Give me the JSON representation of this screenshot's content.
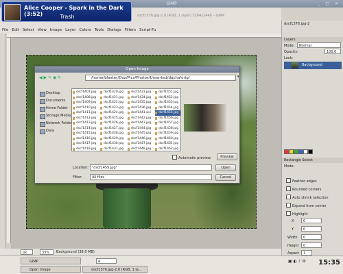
{
  "window": {
    "title": "GIMP",
    "controls": "_ □ ×"
  },
  "notification": {
    "title": "Alice Cooper - Spark in the Dark (3:52)",
    "subtitle": "Trash"
  },
  "image_window": {
    "title": "dscf1376.jpg-2.0 (RGB, 1 layer) 3264x2448 – GIMP"
  },
  "menubar": [
    "File",
    "Edit",
    "Select",
    "View",
    "Image",
    "Layer",
    "Colors",
    "Tools",
    "Dialogs",
    "Filters",
    "Script-Fu"
  ],
  "dialog": {
    "title": "Open Image",
    "path": "/home/blaster/Dox/Pics/Photos/Unsorted/dacha/orig/",
    "places": [
      "Desktop",
      "Documents",
      "Home Folder",
      "Storage Media",
      "Network Folders",
      "Data"
    ],
    "file_columns": [
      [
        "dscf1407.jpg",
        "dscf1408.jpg",
        "dscf1409.jpg",
        "dscf1410.jpg",
        "dscf1411.jpg",
        "dscf1412.jpg",
        "dscf1413.jpg",
        "dscf1414.jpg",
        "dscf1415.jpg",
        "dscf1416.jpg",
        "dscf1417.jpg",
        "dscf1418.jpg",
        "dscf1419.jpg"
      ],
      [
        "dscf1420.jpg",
        "dscf1421.jpg",
        "dscf1422.jpg",
        "dscf1423.jpg",
        "dscf1424.jpg",
        "dscf1425.jpg",
        "dscf1426.jpg",
        "dscf1427.jpg",
        "dscf1428.jpg",
        "dscf1429.jpg",
        "dscf1430.jpg",
        "dscf1431.jpg",
        "dscf1432.jpg"
      ],
      [
        "dscf1433.jpg",
        "dscf1434.jpg",
        "dscf1435.jpg",
        "dscf1436.jpg",
        "dscf1441.avi",
        "dscf1442.jpg",
        "dscf1443.jpg",
        "dscf1444.jpg",
        "dscf1445.jpg",
        "dscf1446.jpg",
        "dscf1447.jpg",
        "dscf1448.jpg",
        "dscf1449.jpg"
      ],
      [
        "dscf1451.jpg",
        "dscf1452.jpg",
        "dscf1453.jpg",
        "dscf1454.jpg",
        "dscf1455.jpg",
        "dscf1456.jpg",
        "dscf1457.jpg",
        "dscf1458.jpg",
        "dscf1459.jpg",
        "dscf1460.jpg",
        "dscf1461.jpg",
        "dscf1462.jpg",
        "dscf1463.jpg"
      ]
    ],
    "selected_file": "dscf1455.jpg",
    "automatic_preview": "Automatic preview",
    "preview_button": "Preview",
    "location_label": "Location:",
    "location_value": "\"dscf1455.jpg\"",
    "filter_label": "Filter:",
    "filter_value": "All files",
    "open_button": "Open",
    "cancel_button": "Cancel"
  },
  "statusbar": {
    "unit": "px",
    "zoom": "33%",
    "layer_info": "Background (38.0 MB)"
  },
  "right_panel": {
    "doc_title": "dscf1376.jpg-2",
    "layers_title": "Layers",
    "mode_label": "Mode:",
    "mode_value": "Normal",
    "opacity_label": "Opacity:",
    "opacity_value": "100.0",
    "lock_label": "Lock:",
    "layer_name": "Background",
    "tool_title": "Rectangle Select",
    "tool_mode": "Mode:",
    "options": [
      "Feather edges",
      "Rounded corners",
      "Auto shrink selection",
      "Expand from center",
      "Highlight"
    ],
    "fields": [
      {
        "label": "X",
        "value": "0"
      },
      {
        "label": "Y",
        "value": "0"
      },
      {
        "label": "Width",
        "value": "0"
      },
      {
        "label": "Height",
        "value": "0"
      },
      {
        "label": "Aspect",
        "value": "1"
      }
    ]
  },
  "taskbar": {
    "tasks": [
      "GIMP",
      "Open Image",
      "dscf1376.jpg-2.0 (RGB, 1 la..."
    ],
    "workspace": "4",
    "clock": "15:35"
  }
}
